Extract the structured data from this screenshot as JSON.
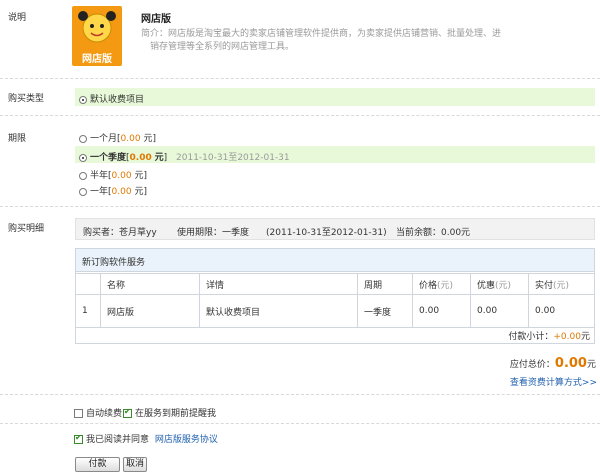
{
  "desc": {
    "label": "说明",
    "app_name": "网店版",
    "logo_text": "网店版",
    "intro_line1": "简介：网店版是淘宝最大的卖家店铺管理软件提供商，为卖家提供店铺营销、批量处理、进",
    "intro_line2": "销存管理等全系列的网店管理工具。"
  },
  "purchase_type": {
    "label": "购买类型",
    "option": "默认收费项目"
  },
  "period": {
    "label": "期限",
    "options": [
      {
        "label": "一个月",
        "price": "0.00",
        "unit": "元"
      },
      {
        "label": "一个季度",
        "price": "0.00",
        "unit": "元",
        "range": "2011-10-31至2012-01-31"
      },
      {
        "label": "半年",
        "price": "0.00",
        "unit": "元"
      },
      {
        "label": "一年",
        "price": "0.00",
        "unit": "元"
      }
    ]
  },
  "detail": {
    "label": "购买明细",
    "buyer": "购买者：苍月草yy",
    "term": "使用期限：一季度",
    "range": "(2011-10-31至2012-01-31)",
    "balance": "当前余额：0.00元",
    "section_title": "新订购软件服务",
    "headers": [
      "名称",
      "详情",
      "周期",
      "价格",
      "优惠",
      "实付"
    ],
    "header_unit": "(元)",
    "row": {
      "no": "1",
      "name": "网店版",
      "detail": "默认收费项目",
      "period": "一季度",
      "price": "0.00",
      "discount": "0.00",
      "paid": "0.00"
    },
    "subtotal_label": "付款小计：",
    "subtotal_value": "+0.00",
    "subtotal_unit": "元",
    "total_label": "应付总价：",
    "total_value": "0.00",
    "total_unit": "元",
    "calc_link": "查看资费计算方式>>"
  },
  "options": {
    "auto_renew": "自动续费",
    "remind": "在服务到期前提醒我",
    "agree_prefix": "我已阅读并同意",
    "agree_link": "网店版服务协议"
  },
  "buttons": {
    "pay": "付款",
    "cancel": "取消"
  },
  "colors": {
    "accent": "#e07800",
    "highlight": "#e8f9d9",
    "link": "#1f5fae"
  }
}
